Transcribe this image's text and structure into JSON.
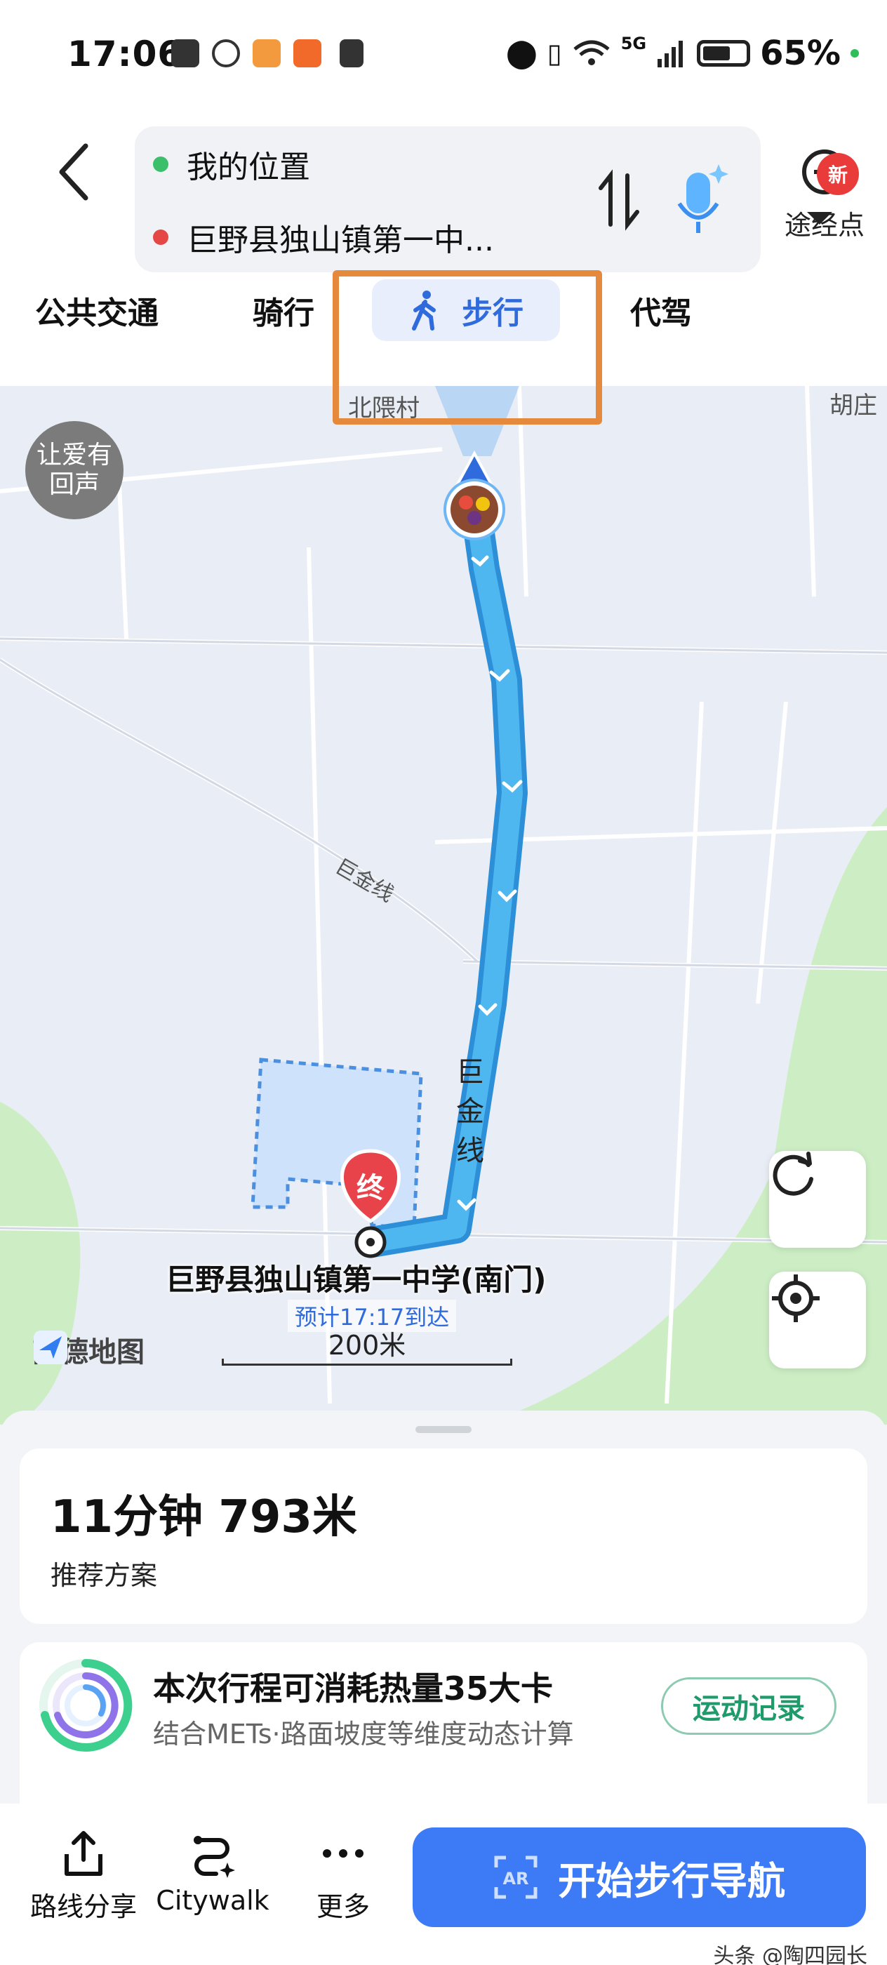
{
  "status_bar": {
    "time": "17:06",
    "battery": "65%",
    "network": "5G"
  },
  "header": {
    "origin": "我的位置",
    "destination": "巨野县独山镇第一中...",
    "waypoint_label": "途经点",
    "icons": [
      "back-icon",
      "swap-icon",
      "mic-icon",
      "add-waypoint-icon"
    ]
  },
  "tabs": {
    "items": [
      "公共交通",
      "骑行",
      "步行",
      "代驾"
    ],
    "active": "步行",
    "new_badge": "新"
  },
  "map": {
    "charity_badge": "让爱有回声",
    "labels": {
      "village": "北隈村",
      "village_right": "胡庄",
      "road_diag": "巨金线",
      "road_vertical": "巨金线"
    },
    "destination_marker": "终",
    "destination_name": "巨野县独山镇第一中学(南门)",
    "eta": "预计17:17到达",
    "brand": "高德地图",
    "scale": "200米",
    "route_color": "#4fb7ef",
    "green_color": "#cdeec5"
  },
  "plan_card": {
    "summary": "11分钟  793米",
    "subtitle": "推荐方案"
  },
  "calorie_card": {
    "title": "本次行程可消耗热量35大卡",
    "subtitle": "结合METs·路面坡度等维度动态计算",
    "button": "运动记录"
  },
  "bottom_bar": {
    "share": "路线分享",
    "citywalk": "Citywalk",
    "more": "更多",
    "start_nav": "开始步行导航"
  },
  "watermark": "头条 @陶四园长"
}
